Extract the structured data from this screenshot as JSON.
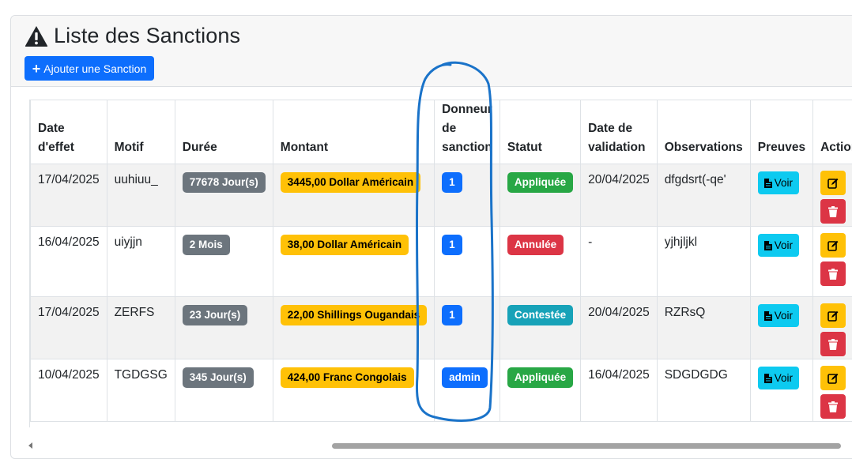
{
  "page": {
    "title": "Liste des Sanctions",
    "add_button": "Ajouter une Sanction"
  },
  "table": {
    "headers": {
      "date_effet": "Date d'effet",
      "motif": "Motif",
      "duree": "Durée",
      "montant": "Montant",
      "donneur": "Donneur de sanction",
      "statut": "Statut",
      "date_validation": "Date de validation",
      "observations": "Observations",
      "preuves": "Preuves",
      "actions": "Actions"
    },
    "rows": [
      {
        "date_effet": "17/04/2025",
        "motif": "uuhiuu_",
        "duree": "77678 Jour(s)",
        "montant": "3445,00 Dollar Américain",
        "donneur": "1",
        "statut": "Appliquée",
        "date_validation": "20/04/2025",
        "observations": "dfgdsrt(-qe'",
        "preuves": "Voir"
      },
      {
        "date_effet": "16/04/2025",
        "motif": "uiyjjn",
        "duree": "2 Mois",
        "montant": "38,00 Dollar Américain",
        "donneur": "1",
        "statut": "Annulée",
        "date_validation": "-",
        "observations": "yjhjljkl",
        "preuves": "Voir"
      },
      {
        "date_effet": "17/04/2025",
        "motif": "ZERFS",
        "duree": "23 Jour(s)",
        "montant": "22,00 Shillings Ougandais",
        "donneur": "1",
        "statut": "Contestée",
        "date_validation": "20/04/2025",
        "observations": "RZRsQ",
        "preuves": "Voir"
      },
      {
        "date_effet": "10/04/2025",
        "motif": "TGDGSG",
        "duree": "345 Jour(s)",
        "montant": "424,00 Franc Congolais",
        "donneur": "admin",
        "statut": "Appliquée",
        "date_validation": "16/04/2025",
        "observations": "SDGDGDG",
        "preuves": "Voir"
      }
    ]
  },
  "colors": {
    "primary": "#0d6efd",
    "secondary": "#6c757d",
    "warning": "#ffc107",
    "success": "#28a745",
    "danger": "#dc3545",
    "info": "#17a2b8",
    "info_light": "#0dcaf0",
    "annotation": "#1a73c9"
  },
  "icons": {
    "title": "warning-triangle-icon",
    "add": "plus-icon",
    "proof": "file-icon",
    "edit": "edit-icon",
    "delete": "trash-icon"
  }
}
